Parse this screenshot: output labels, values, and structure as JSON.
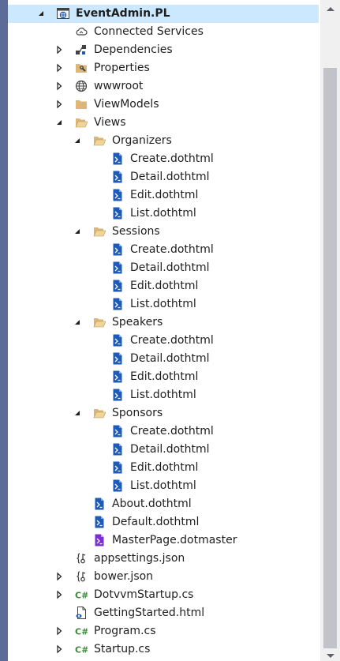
{
  "tree": {
    "items": [
      {
        "label": "EventAdmin.PL",
        "depth": 0,
        "icon": "web-project-icon",
        "expander": "expanded",
        "bold": true,
        "selected": true
      },
      {
        "label": "Connected Services",
        "depth": 1,
        "icon": "connected-services-icon",
        "expander": "none"
      },
      {
        "label": "Dependencies",
        "depth": 1,
        "icon": "dependencies-icon",
        "expander": "collapsed"
      },
      {
        "label": "Properties",
        "depth": 1,
        "icon": "properties-folder-icon",
        "expander": "collapsed"
      },
      {
        "label": "wwwroot",
        "depth": 1,
        "icon": "globe-icon",
        "expander": "collapsed"
      },
      {
        "label": "ViewModels",
        "depth": 1,
        "icon": "folder-icon",
        "expander": "collapsed"
      },
      {
        "label": "Views",
        "depth": 1,
        "icon": "open-folder-icon",
        "expander": "expanded"
      },
      {
        "label": "Organizers",
        "depth": 2,
        "icon": "open-folder-icon",
        "expander": "expanded"
      },
      {
        "label": "Create.dothtml",
        "depth": 3,
        "icon": "dothtml-file-icon",
        "expander": "none"
      },
      {
        "label": "Detail.dothtml",
        "depth": 3,
        "icon": "dothtml-file-icon",
        "expander": "none"
      },
      {
        "label": "Edit.dothtml",
        "depth": 3,
        "icon": "dothtml-file-icon",
        "expander": "none"
      },
      {
        "label": "List.dothtml",
        "depth": 3,
        "icon": "dothtml-file-icon",
        "expander": "none"
      },
      {
        "label": "Sessions",
        "depth": 2,
        "icon": "open-folder-icon",
        "expander": "expanded"
      },
      {
        "label": "Create.dothtml",
        "depth": 3,
        "icon": "dothtml-file-icon",
        "expander": "none"
      },
      {
        "label": "Detail.dothtml",
        "depth": 3,
        "icon": "dothtml-file-icon",
        "expander": "none"
      },
      {
        "label": "Edit.dothtml",
        "depth": 3,
        "icon": "dothtml-file-icon",
        "expander": "none"
      },
      {
        "label": "List.dothtml",
        "depth": 3,
        "icon": "dothtml-file-icon",
        "expander": "none"
      },
      {
        "label": "Speakers",
        "depth": 2,
        "icon": "open-folder-icon",
        "expander": "expanded"
      },
      {
        "label": "Create.dothtml",
        "depth": 3,
        "icon": "dothtml-file-icon",
        "expander": "none"
      },
      {
        "label": "Detail.dothtml",
        "depth": 3,
        "icon": "dothtml-file-icon",
        "expander": "none"
      },
      {
        "label": "Edit.dothtml",
        "depth": 3,
        "icon": "dothtml-file-icon",
        "expander": "none"
      },
      {
        "label": "List.dothtml",
        "depth": 3,
        "icon": "dothtml-file-icon",
        "expander": "none"
      },
      {
        "label": "Sponsors",
        "depth": 2,
        "icon": "open-folder-icon",
        "expander": "expanded"
      },
      {
        "label": "Create.dothtml",
        "depth": 3,
        "icon": "dothtml-file-icon",
        "expander": "none"
      },
      {
        "label": "Detail.dothtml",
        "depth": 3,
        "icon": "dothtml-file-icon",
        "expander": "none"
      },
      {
        "label": "Edit.dothtml",
        "depth": 3,
        "icon": "dothtml-file-icon",
        "expander": "none"
      },
      {
        "label": "List.dothtml",
        "depth": 3,
        "icon": "dothtml-file-icon",
        "expander": "none"
      },
      {
        "label": "About.dothtml",
        "depth": 2,
        "icon": "dothtml-file-icon",
        "expander": "none"
      },
      {
        "label": "Default.dothtml",
        "depth": 2,
        "icon": "dothtml-file-icon",
        "expander": "none"
      },
      {
        "label": "MasterPage.dotmaster",
        "depth": 2,
        "icon": "dotmaster-file-icon",
        "expander": "none"
      },
      {
        "label": "appsettings.json",
        "depth": 1,
        "icon": "json-file-icon",
        "expander": "none"
      },
      {
        "label": "bower.json",
        "depth": 1,
        "icon": "json-file-icon",
        "expander": "collapsed"
      },
      {
        "label": "DotvvmStartup.cs",
        "depth": 1,
        "icon": "csharp-file-icon",
        "expander": "collapsed"
      },
      {
        "label": "GettingStarted.html",
        "depth": 1,
        "icon": "html-file-icon",
        "expander": "none"
      },
      {
        "label": "Program.cs",
        "depth": 1,
        "icon": "csharp-file-icon",
        "expander": "collapsed"
      },
      {
        "label": "Startup.cs",
        "depth": 1,
        "icon": "csharp-file-icon",
        "expander": "collapsed"
      }
    ]
  },
  "colors": {
    "frame": "#5d6b99",
    "selection": "#cce8ff",
    "text": "#1e1e1e",
    "folder": "#dcb67a",
    "dothtml": "#1e5bb8",
    "dotmaster": "#7b2fd1",
    "csharp": "#388a34",
    "scroll_thumb": "#c2c3c9"
  },
  "scrollbar": {
    "position": 0.0,
    "visible_fraction": 0.93
  }
}
